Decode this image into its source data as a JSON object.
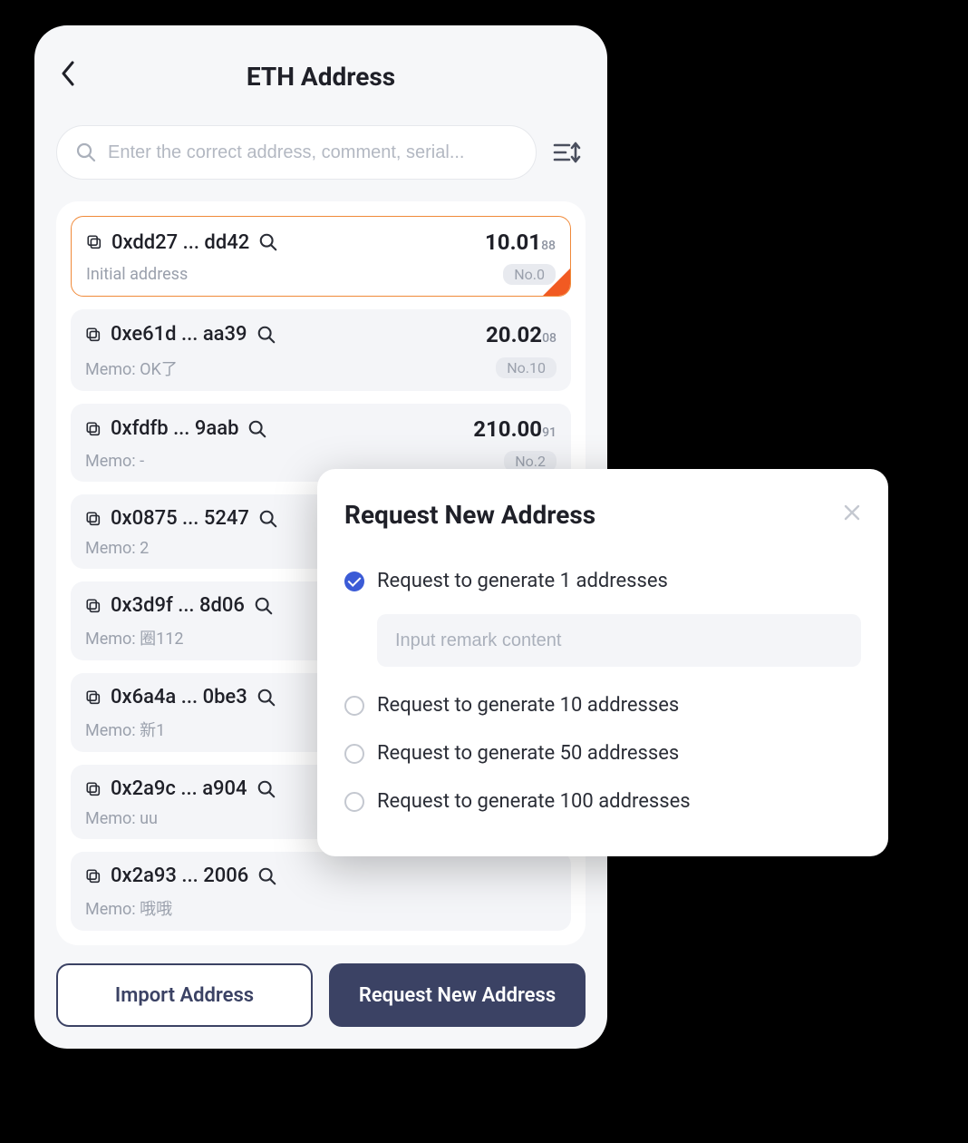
{
  "header": {
    "title": "ETH Address"
  },
  "search": {
    "placeholder": "Enter the correct address, comment, serial..."
  },
  "addresses": [
    {
      "addr": "0xdd27 ... dd42",
      "balance_main": "10.01",
      "balance_sub": "88",
      "memo": "Initial address",
      "no": "No.0",
      "selected": true
    },
    {
      "addr": "0xe61d ... aa39",
      "balance_main": "20.02",
      "balance_sub": "08",
      "memo": "Memo: OK了",
      "no": "No.10",
      "selected": false
    },
    {
      "addr": "0xfdfb ... 9aab",
      "balance_main": "210.00",
      "balance_sub": "91",
      "memo": "Memo: -",
      "no": "No.2",
      "selected": false
    },
    {
      "addr": "0x0875 ... 5247",
      "balance_main": "",
      "balance_sub": "",
      "memo": "Memo: 2",
      "no": "",
      "selected": false
    },
    {
      "addr": "0x3d9f ... 8d06",
      "balance_main": "",
      "balance_sub": "",
      "memo": "Memo: 圈112",
      "no": "",
      "selected": false
    },
    {
      "addr": "0x6a4a ... 0be3",
      "balance_main": "",
      "balance_sub": "",
      "memo": "Memo: 新1",
      "no": "",
      "selected": false
    },
    {
      "addr": "0x2a9c ... a904",
      "balance_main": "",
      "balance_sub": "",
      "memo": "Memo: uu",
      "no": "",
      "selected": false
    },
    {
      "addr": "0x2a93 ... 2006",
      "balance_main": "",
      "balance_sub": "",
      "memo": "Memo: 哦哦",
      "no": "",
      "selected": false
    }
  ],
  "footer": {
    "import_label": "Import Address",
    "request_label": "Request New Address"
  },
  "modal": {
    "title": "Request New Address",
    "remark_placeholder": "Input remark content",
    "options": [
      {
        "label": "Request to generate 1 addresses",
        "checked": true
      },
      {
        "label": "Request to generate 10 addresses",
        "checked": false
      },
      {
        "label": "Request to generate 50 addresses",
        "checked": false
      },
      {
        "label": "Request to generate 100 addresses",
        "checked": false
      }
    ]
  }
}
